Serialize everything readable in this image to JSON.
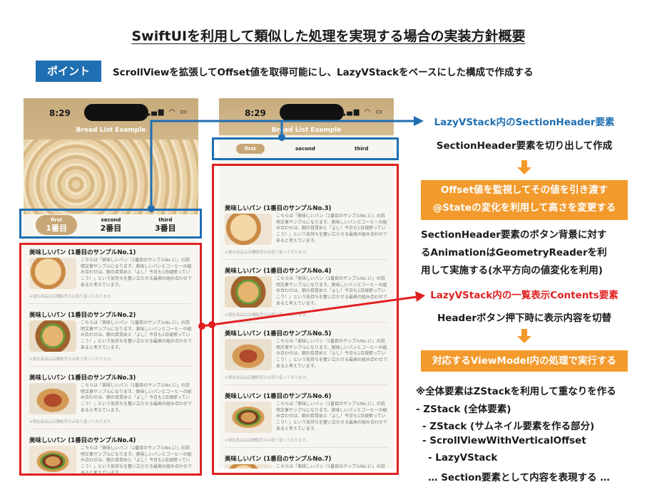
{
  "title": "SwiftUIを利用して類似した処理を実現する場合の実装方針概要",
  "point": {
    "label": "ポイント",
    "text": "ScrollViewを拡張してOffset値を取得可能にし、LazyVStackをベースにした構成で作成する"
  },
  "phone": {
    "time": "8:29",
    "nav_title": "Bread List Example",
    "tabs": [
      {
        "small": "first",
        "label": "1番目"
      },
      {
        "small": "second",
        "label": "2番目"
      },
      {
        "small": "third",
        "label": "3番目"
      }
    ],
    "item_desc": "こちらは「美味しいパン（1番目のサンプルNo.1）」の説明文章サンプルになります。美味しいパンとコーヒーの組み合わせは、朝の目覚めと「よし！今日も1日頑張っていこう！」という気持ちを奮い立たせる最高の組み合わせであると考えています。",
    "item_note": "※現在商品は店舗販売のみ取り扱っております。",
    "left_items": [
      "美味しいパン (1番目のサンプルNo.1)",
      "美味しいパン (1番目のサンプルNo.2)",
      "美味しいパン (1番目のサンプルNo.3)",
      "美味しいパン (1番目のサンプルNo.4)"
    ],
    "right_items": [
      "美味しいパン (1番目のサンプルNo.3)",
      "美味しいパン (1番目のサンプルNo.4)",
      "美味しいパン (1番目のサンプルNo.5)",
      "美味しいパン (1番目のサンプルNo.6)",
      "美味しいパン (1番目のサンプルNo.7)"
    ]
  },
  "right": {
    "header_title": "LazyVStack内のSectionHeader要素",
    "header_desc": "SectionHeader要素を切り出して作成",
    "offset_box": [
      "Offset値を監視してその値を引き渡す",
      "@Stateの変化を利用して高さを変更する"
    ],
    "anim_desc": [
      "SectionHeader要素のボタン背景に対す",
      "るAnimationはGeometryReaderを利",
      "用して実施する(水平方向の値変化を利用)"
    ],
    "contents_title": "LazyVStack内の一覧表示Contents要素",
    "contents_desc": "Headerボタン押下時に表示内容を切替",
    "viewmodel_box": "対応するViewModel内の処理で実行する",
    "notes": [
      "※全体要素はZStackを利用して重なりを作る",
      "- ZStack (全体要素)",
      "- ZStack (サムネイル要素を作る部分)",
      "- ScrollViewWithVerticalOffset",
      "- LazyVStack",
      "… Section要素として内容を表現する …"
    ]
  },
  "colors": {
    "blue": "#1f6fb2",
    "red": "#e02020",
    "orange": "#f39a2c",
    "header_bg": "#c8ab7b"
  }
}
